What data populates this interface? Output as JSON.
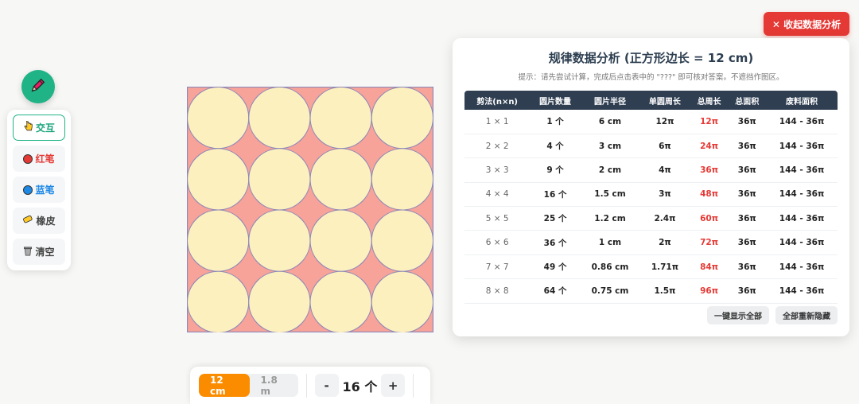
{
  "toolbar": {
    "pencil_icon": "pencil-icon",
    "tools": [
      {
        "label": "交互",
        "icon": "pointer-hand-icon"
      },
      {
        "label": "红笔",
        "icon": "red-dot-icon",
        "color": "#e53935"
      },
      {
        "label": "蓝笔",
        "icon": "blue-dot-icon",
        "color": "#1e88e5"
      },
      {
        "label": "橡皮",
        "icon": "eraser-icon"
      },
      {
        "label": "清空",
        "icon": "trash-icon"
      }
    ]
  },
  "canvas": {
    "grid_n": 4,
    "square_color": "#f7a399",
    "circle_color": "#fdf0bf",
    "stroke_color": "#8e88b8"
  },
  "controls": {
    "size_options": [
      "12 cm",
      "1.8 m"
    ],
    "active_size": "12 cm",
    "minus_label": "-",
    "plus_label": "+",
    "count_label": "16 个"
  },
  "collapse_button": "✕ 收起数据分析",
  "panel": {
    "title": "规律数据分析 (正方形边长 = 12 cm)",
    "hint": "提示：请先尝试计算，完成后点击表中的 \"???\" 即可核对答案。不遮挡作图区。",
    "headers": [
      "剪法(n×n)",
      "圆片数量",
      "圆片半径",
      "单圆周长",
      "总周长",
      "总面积",
      "废料面积"
    ],
    "rows": [
      [
        "1 × 1",
        "1 个",
        "6 cm",
        "12π",
        "12π",
        "36π",
        "144 - 36π"
      ],
      [
        "2 × 2",
        "4 个",
        "3 cm",
        "6π",
        "24π",
        "36π",
        "144 - 36π"
      ],
      [
        "3 × 3",
        "9 个",
        "2 cm",
        "4π",
        "36π",
        "36π",
        "144 - 36π"
      ],
      [
        "4 × 4",
        "16 个",
        "1.5 cm",
        "3π",
        "48π",
        "36π",
        "144 - 36π"
      ],
      [
        "5 × 5",
        "25 个",
        "1.2 cm",
        "2.4π",
        "60π",
        "36π",
        "144 - 36π"
      ],
      [
        "6 × 6",
        "36 个",
        "1 cm",
        "2π",
        "72π",
        "36π",
        "144 - 36π"
      ],
      [
        "7 × 7",
        "49 个",
        "0.86 cm",
        "1.71π",
        "84π",
        "36π",
        "144 - 36π"
      ],
      [
        "8 × 8",
        "64 个",
        "0.75 cm",
        "1.5π",
        "96π",
        "36π",
        "144 - 36π"
      ]
    ],
    "show_all": "一键显示全部",
    "hide_all": "全部重新隐藏"
  }
}
